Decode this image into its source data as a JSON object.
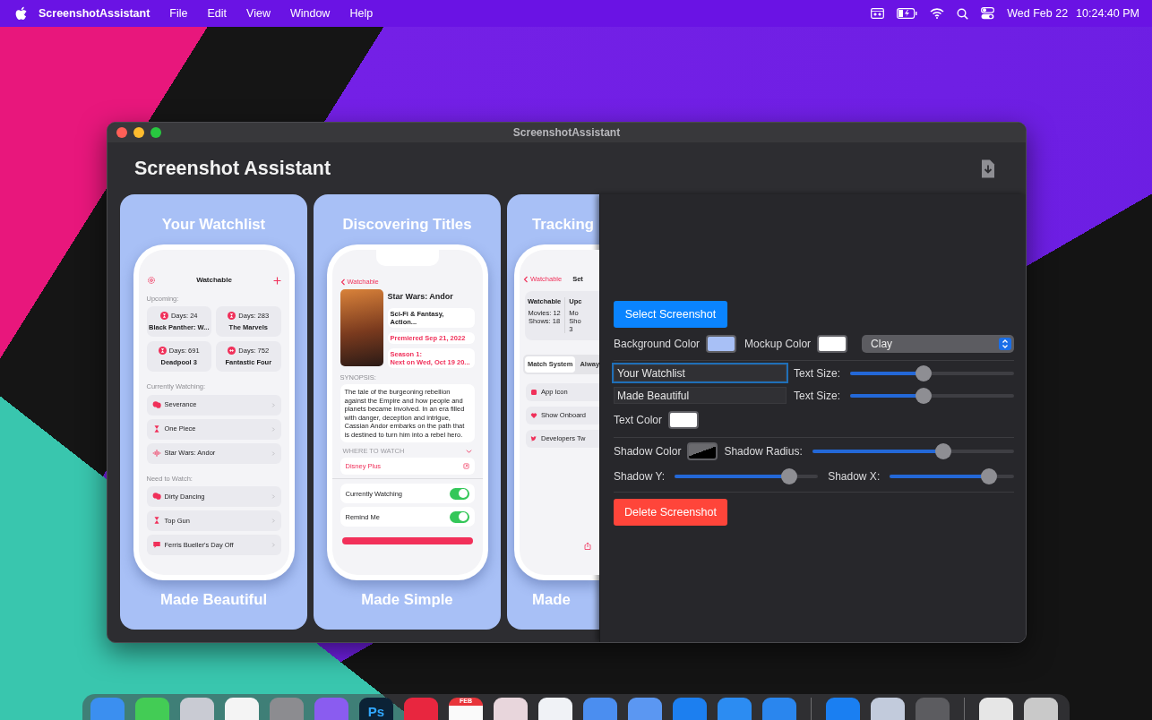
{
  "menu_bar": {
    "app_name": "ScreenshotAssistant",
    "menus": [
      "File",
      "Edit",
      "View",
      "Window",
      "Help"
    ],
    "date": "Wed Feb 22",
    "time": "10:24:40 PM"
  },
  "window": {
    "title": "ScreenshotAssistant",
    "heading": "Screenshot Assistant",
    "previews": [
      {
        "kind": "list",
        "top_text": "Your Watchlist",
        "bottom_text": "Made Beautiful",
        "screen": {
          "title": "Watchable",
          "upcoming_label": "Upcoming:",
          "upcoming": [
            {
              "kind": "hourglass",
              "days": "Days: 24",
              "title": "Black Panther: W..."
            },
            {
              "kind": "hourglass",
              "days": "Days: 283",
              "title": "The Marvels"
            },
            {
              "kind": "hourglass",
              "days": "Days: 691",
              "title": "Deadpool 3"
            },
            {
              "kind": "audio",
              "days": "Days: 752",
              "title": "Fantastic Four"
            }
          ],
          "groups": [
            {
              "label": "Currently Watching:",
              "rows": [
                {
                  "kind": "theater",
                  "title": "Severance"
                },
                {
                  "kind": "hourglass",
                  "title": "One Piece"
                },
                {
                  "kind": "audio",
                  "title": "Star Wars: Andor"
                }
              ]
            },
            {
              "label": "Need to Watch:",
              "rows": [
                {
                  "kind": "theater",
                  "title": "Dirty Dancing"
                },
                {
                  "kind": "hourglass",
                  "title": "Top Gun"
                },
                {
                  "kind": "message",
                  "title": "Ferris Bueller's Day Off"
                }
              ]
            }
          ]
        }
      },
      {
        "kind": "detail",
        "top_text": "Discovering Titles",
        "bottom_text": "Made Simple",
        "screen": {
          "back": "Watchable",
          "title": "Star Wars: Andor",
          "chips": [
            {
              "lines": [
                "Sci-Fi & Fantasy, Action..."
              ],
              "accent": false
            },
            {
              "lines": [
                "Premiered Sep 21, 2022"
              ],
              "accent": true
            },
            {
              "lines": [
                "Season 1:",
                "Next on Wed, Oct 19 20..."
              ],
              "accent": true
            }
          ],
          "synopsis_label": "SYNOPSIS:",
          "synopsis": "The tale of the burgeoning rebellion against the Empire and how people and planets became involved. In an era filled with danger, deception and intrigue, Cassian Andor embarks on the path that is destined to turn him into a rebel hero.",
          "where_label": "WHERE TO WATCH",
          "provider": "Disney Plus",
          "toggles": [
            {
              "label": "Currently Watching",
              "on": true
            },
            {
              "label": "Remind Me",
              "on": true
            }
          ]
        }
      },
      {
        "kind": "settings",
        "top_text": "Tracking",
        "bottom_text": "Made",
        "screen": {
          "back": "Watchable",
          "title": "Set",
          "stats": [
            {
              "title": "Watchable",
              "lines": [
                "Movies: 12",
                "Shows: 18"
              ]
            },
            {
              "title": "Upc",
              "lines": [
                "Mo",
                "Sho",
                "3"
              ]
            }
          ],
          "segments": [
            {
              "label": "Match System",
              "selected": true
            },
            {
              "label": "Alway",
              "selected": false
            }
          ],
          "rows": [
            {
              "kind": "app",
              "title": "App Icon"
            },
            {
              "kind": "heart",
              "title": "Show Onboard"
            },
            {
              "kind": "bird",
              "title": "Developers Tw"
            }
          ]
        }
      }
    ],
    "panel": {
      "select_button": "Select Screenshot",
      "background": {
        "label": "Background Color",
        "color": "#a8c0f6"
      },
      "mockup": {
        "label": "Mockup Color",
        "color": "#ffffff"
      },
      "style": "Clay",
      "text_rows": [
        {
          "value": "Your Watchlist",
          "focused": true,
          "size_label": "Text Size:",
          "level": 0.45
        },
        {
          "value": "Made Beautiful",
          "focused": false,
          "size_label": "Text Size:",
          "level": 0.45
        }
      ],
      "text_color": {
        "label": "Text Color",
        "color": "#ffffff"
      },
      "shadow_color": {
        "label": "Shadow Color",
        "color": "#000000"
      },
      "shadow_radius": {
        "label": "Shadow Radius:",
        "level": 0.65
      },
      "shadow_y": {
        "label": "Shadow Y:",
        "level": 0.8
      },
      "shadow_x": {
        "label": "Shadow X:",
        "level": 0.8
      },
      "delete_button": "Delete Screenshot"
    }
  },
  "dock": [
    {
      "items": [
        {
          "color": "#3b8ff0"
        },
        {
          "color": "#43cc55"
        },
        {
          "color": "#c9cbd3"
        },
        {
          "color": "#f4f4f4"
        },
        {
          "color": "#8c8c90"
        },
        {
          "color": "#8a5cf0"
        },
        {
          "color": "#0b2236",
          "label": "Ps"
        },
        {
          "color": "#e8263f"
        },
        {
          "color": "#fafafa",
          "label": "FEB"
        },
        {
          "color": "#e8d6dc"
        },
        {
          "color": "#f0f2f6"
        },
        {
          "color": "#4b8ef0"
        },
        {
          "color": "#5b97f2"
        },
        {
          "color": "#1c7ff0"
        },
        {
          "color": "#2c8cf2"
        },
        {
          "color": "#2a86ee"
        }
      ]
    },
    {
      "items": [
        {
          "color": "#1a7ff2"
        },
        {
          "color": "#c2cbdc"
        },
        {
          "color": "#5c5c60"
        }
      ]
    },
    {
      "items": [
        {
          "color": "#e6e6e6"
        },
        {
          "color": "#c9c9c9"
        }
      ]
    }
  ]
}
